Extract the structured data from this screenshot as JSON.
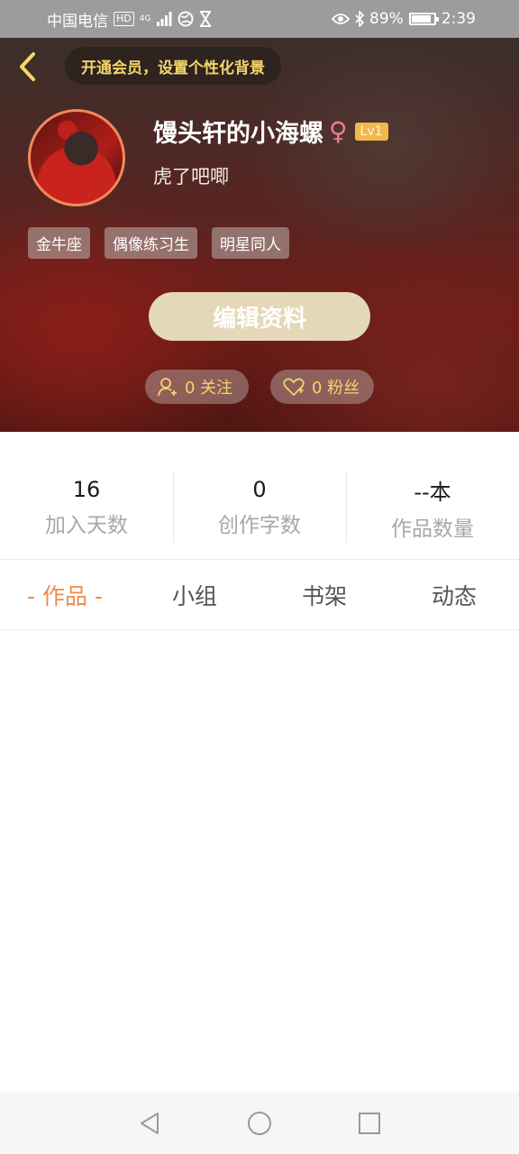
{
  "status_bar": {
    "carrier": "中国电信",
    "hd": "HD",
    "network": "4G",
    "battery_percent": "89%",
    "battery_level": 0.89,
    "time": "2:39"
  },
  "header": {
    "vip_promo": "开通会员，设置个性化背景"
  },
  "profile": {
    "username": "馒头轩的小海螺",
    "gender_symbol": "♀",
    "level": "Lv1",
    "bio": "虎了吧唧",
    "tags": [
      "金牛座",
      "偶像练习生",
      "明星同人"
    ],
    "edit_button": "编辑资料",
    "following": "0 关注",
    "fans": "0 粉丝"
  },
  "stats": [
    {
      "value": "16",
      "label": "加入天数"
    },
    {
      "value": "0",
      "label": "创作字数"
    },
    {
      "value": "--本",
      "label": "作品数量"
    }
  ],
  "tabs": [
    "- 作品 -",
    "小组",
    "书架",
    "动态"
  ],
  "colors": {
    "accent_gold": "#f3d56a",
    "tab_active": "#f08a4b",
    "edit_button_bg": "#e5d8b8",
    "level_badge": "#f2b84b"
  },
  "icons": [
    "back-icon",
    "follow-icon",
    "heart-icon",
    "nav-back-icon",
    "nav-home-icon",
    "nav-recent-icon"
  ]
}
